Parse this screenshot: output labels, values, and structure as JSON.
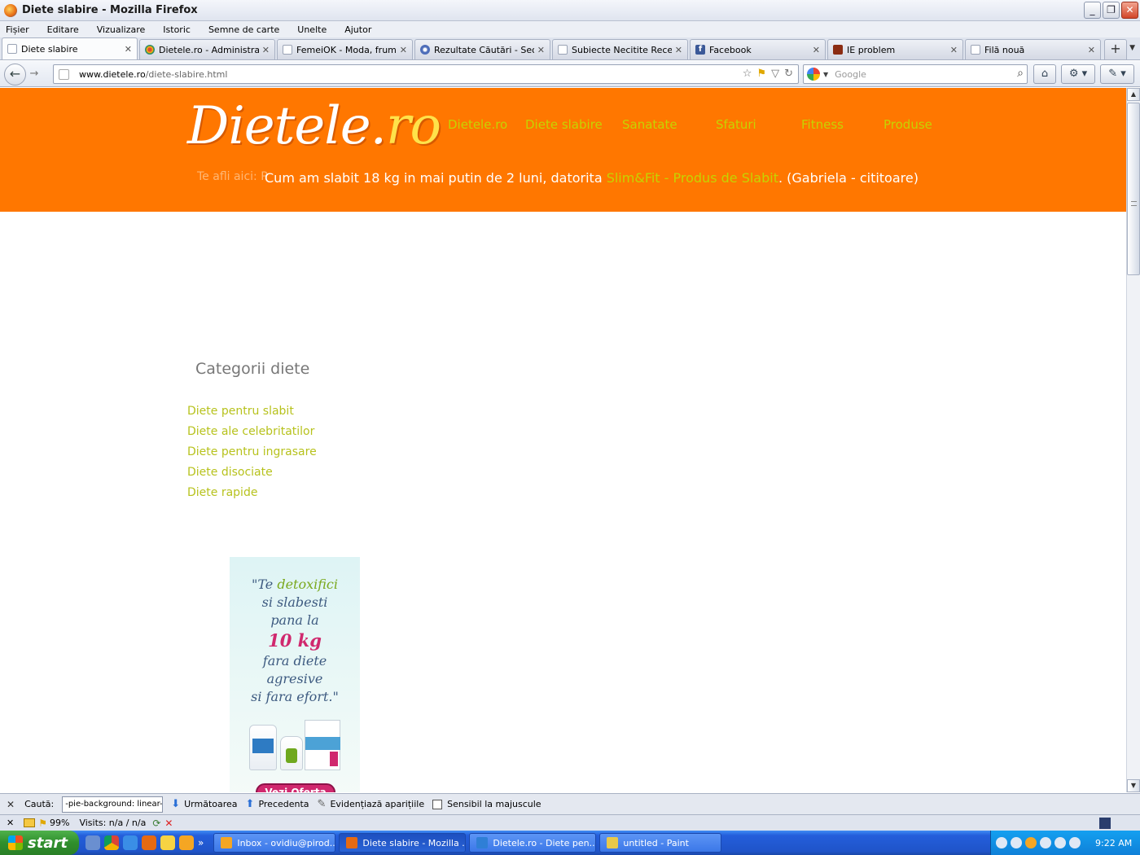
{
  "window": {
    "title": "Diete slabire - Mozilla Firefox",
    "controls": {
      "minimize": "_",
      "maximize": "❐",
      "close": "✕"
    }
  },
  "menubar": [
    "Fișier",
    "Editare",
    "Vizualizare",
    "Istoric",
    "Semne de carte",
    "Unelte",
    "Ajutor"
  ],
  "tabs": [
    {
      "label": "Diete slabire",
      "favicon": "blank-page-icon",
      "active": true
    },
    {
      "label": "Dietele.ro - Administration",
      "favicon": "joomla-icon"
    },
    {
      "label": "FemeiOK - Moda, frumu...",
      "favicon": "blank-page-icon"
    },
    {
      "label": "Rezultate Căutări - Seo...",
      "favicon": "seo-icon"
    },
    {
      "label": "Subiecte Necitite Recente",
      "favicon": "blank-page-icon"
    },
    {
      "label": "Facebook",
      "favicon": "facebook-icon"
    },
    {
      "label": "IE problem",
      "favicon": "ie-problem-icon"
    },
    {
      "label": "Filă nouă",
      "favicon": "blank-page-icon"
    }
  ],
  "tab_close_glyph": "✕",
  "new_tab_glyph": "+",
  "url": {
    "host": "www.dietele.ro",
    "path": "/diete-slabire.html"
  },
  "search": {
    "placeholder": "Google"
  },
  "site": {
    "logo_main": "Dietele.",
    "logo_accent": "ro",
    "nav": [
      "Dietele.ro",
      "Diete slabire",
      "Sanatate",
      "Sfaturi",
      "Fitness",
      "Produse"
    ],
    "breadcrumb_ghost": "Te afli aici: P",
    "testimonial_prefix": "Cum am slabit 18 kg in mai putin de 2 luni, datorita ",
    "testimonial_link": "Slim&Fit - Produs de Slabit",
    "testimonial_suffix": ". (Gabriela - cititoare)",
    "accent_color": "#ff7700",
    "link_color": "#c6d300"
  },
  "categories": {
    "title": "Categorii diete",
    "items": [
      "Diete pentru slabit",
      "Diete ale celebritatilor",
      "Diete pentru ingrasare",
      "Diete disociate",
      "Diete rapide"
    ]
  },
  "ad": {
    "l1a": "\"Te ",
    "l1b": "detoxifici",
    "l2": "si slabesti",
    "l3": "pana la",
    "big": "10 kg",
    "l4": "fara diete",
    "l5": "agresive",
    "l6": "si fara efort.\"",
    "cta": "Vezi Oferta"
  },
  "findbar": {
    "label": "Caută:",
    "value": "-pie-background: linear-gradient",
    "next": "Următoarea",
    "prev": "Precedenta",
    "highlight": "Evidențiază aparițiile",
    "match_case": "Sensibil la majuscule"
  },
  "statusbar": {
    "zoom": "99%",
    "visits": "Visits: n/a / n/a"
  },
  "taskbar": {
    "start": "start",
    "tasks": [
      {
        "label": "Inbox - ovidiu@pirod...",
        "icon_color": "#f5a623"
      },
      {
        "label": "Diete slabire - Mozilla ...",
        "icon_color": "#e66a12",
        "active": true
      },
      {
        "label": "Dietele.ro - Diete pen...",
        "icon_color": "#2f7fd6"
      },
      {
        "label": "untitled - Paint",
        "icon_color": "#e8c84a"
      }
    ],
    "clock": "9:22 AM"
  }
}
